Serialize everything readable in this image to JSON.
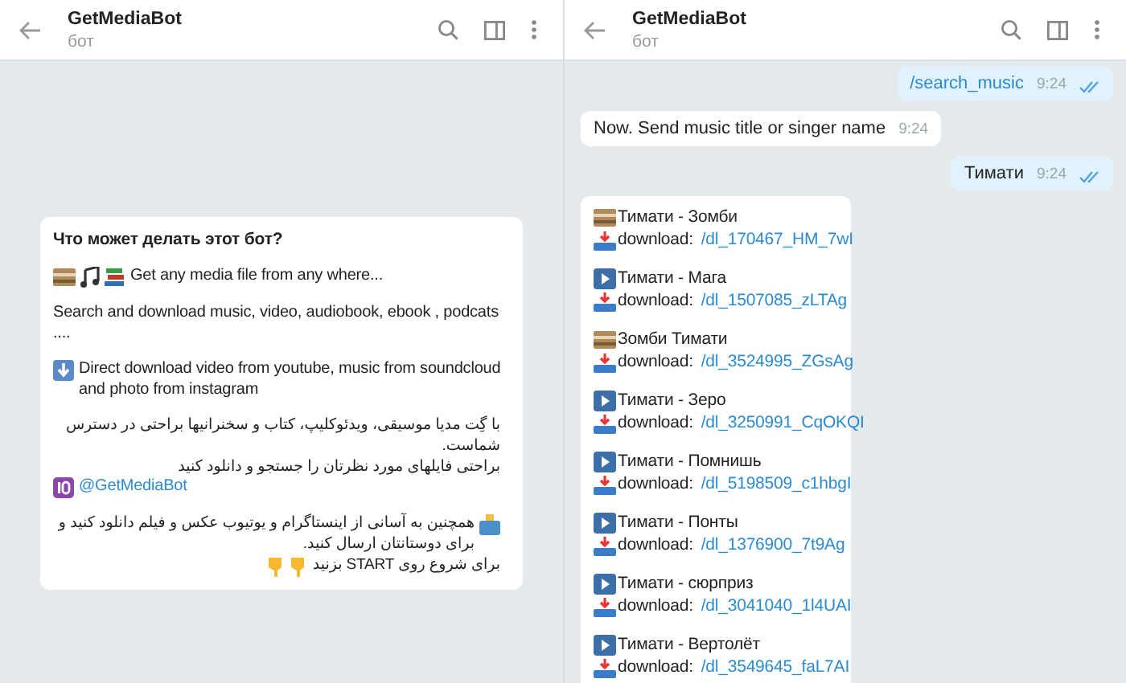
{
  "panels": [
    {
      "header": {
        "title": "GetMediaBot",
        "subtitle": "бот"
      },
      "bot_info": {
        "title": "Что может делать этот бот?",
        "blocks": [
          {
            "kind": "media",
            "text": "Get any media file from any where..."
          },
          {
            "kind": "text",
            "text": "Search and download music, video, audiobook, ebook , podcats ...."
          },
          {
            "kind": "download",
            "text": "Direct download video from youtube, music from soundcloud and photo from instagram"
          },
          {
            "kind": "rtl",
            "lines": [
              "با گِت مدیا موسیقی، ویدئوکلیپ، کتاب و سخنرانیها براحتی در دسترس شماست.",
              "براحتی فایلهای مورد نظرتان را جستجو و دانلود کنید"
            ]
          },
          {
            "kind": "handle",
            "text": "@GetMediaBot"
          },
          {
            "kind": "rtl_ballot",
            "lines": [
              "همچنین به آسانی از اینستاگرام و یوتیوب عکس و فیلم دانلود کنید و برای دوستانتان ارسال کنید.",
              "برای شروع روی START بزنید"
            ]
          }
        ]
      }
    },
    {
      "header": {
        "title": "GetMediaBot",
        "subtitle": "бот"
      },
      "messages": [
        {
          "kind": "outgoing",
          "text": "/search_music",
          "command": true,
          "time": "9:24",
          "read": true
        },
        {
          "kind": "incoming",
          "text": "Now. Send music title or singer name",
          "time": "9:24"
        },
        {
          "kind": "outgoing",
          "text": "Тимати",
          "command": false,
          "time": "9:24",
          "read": true
        },
        {
          "kind": "results",
          "items": [
            {
              "kind": "archive",
              "title": "Тимати - Зомби",
              "label": "download:",
              "link": "/dl_170467_HM_7wI"
            },
            {
              "kind": "video",
              "title": "Тимати - Мага",
              "label": "download:",
              "link": "/dl_1507085_zLTAg"
            },
            {
              "kind": "archive",
              "title": "Зомби Тимати",
              "label": "download:",
              "link": "/dl_3524995_ZGsAg"
            },
            {
              "kind": "video",
              "title": "Тимати - Зеро",
              "label": "download:",
              "link": "/dl_3250991_CqOKQI"
            },
            {
              "kind": "video",
              "title": "Тимати - Помнишь",
              "label": "download:",
              "link": "/dl_5198509_c1hbgI"
            },
            {
              "kind": "video",
              "title": "Тимати - Понты",
              "label": "download:",
              "link": "/dl_1376900_7t9Ag"
            },
            {
              "kind": "video",
              "title": "Тимати - сюрприз",
              "label": "download:",
              "link": "/dl_3041040_1l4UAI"
            },
            {
              "kind": "video",
              "title": "Тимати - Вертолёт",
              "label": "download:",
              "link": "/dl_3549645_faL7AI"
            }
          ]
        }
      ]
    }
  ]
}
